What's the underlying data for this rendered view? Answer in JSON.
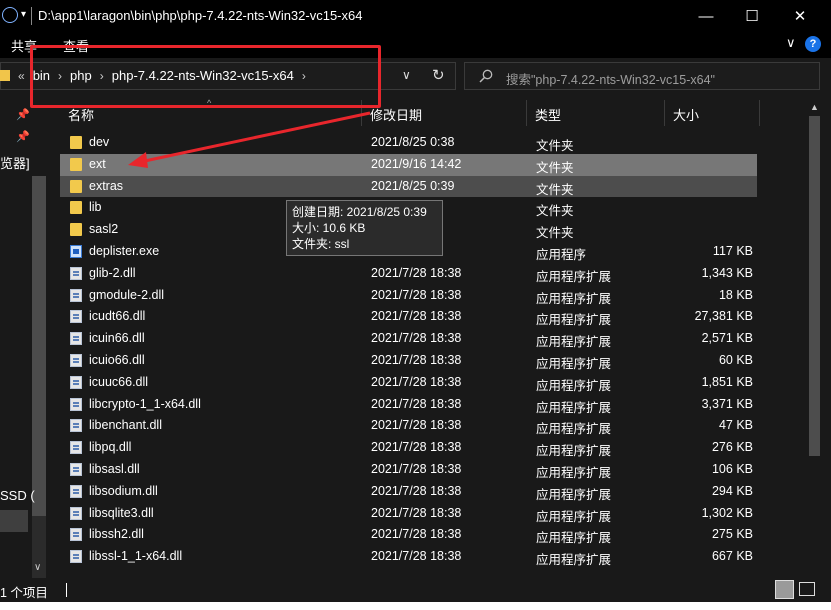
{
  "window": {
    "title_path": "D:\\app1\\laragon\\bin\\php\\php-7.4.22-nts-Win32-vc15-x64",
    "quick_access_arrow": "▾",
    "minimize": "—",
    "maximize": "☐",
    "close": "✕"
  },
  "ribbon": {
    "tabs": [
      "共享",
      "查看"
    ],
    "expand_chevron": "∨",
    "help": "?"
  },
  "address": {
    "overflow": "«",
    "crumbs": [
      "bin",
      "php",
      "php-7.4.22-nts-Win32-vc15-x64"
    ],
    "separator": "›",
    "dropdown": "∨",
    "refresh": "↻"
  },
  "search": {
    "icon": "search-icon",
    "placeholder": "搜索\"php-7.4.22-nts-Win32-vc15-x64\""
  },
  "nav": {
    "pins": [
      "📌",
      "📌"
    ],
    "label_1": "览器]",
    "label_2": "SSD (",
    "scroll_down": "∨"
  },
  "columns": {
    "name": "名称",
    "modified": "修改日期",
    "type": "类型",
    "size": "大小",
    "sort_caret": "^"
  },
  "files": [
    {
      "name": "dev",
      "date": "2021/8/25 0:38",
      "type": "文件夹",
      "size": "",
      "icon": "folder"
    },
    {
      "name": "ext",
      "date": "2021/9/16 14:42",
      "type": "文件夹",
      "size": "",
      "icon": "folder"
    },
    {
      "name": "extras",
      "date": "2021/8/25 0:39",
      "type": "文件夹",
      "size": "",
      "icon": "folder"
    },
    {
      "name": "lib",
      "date": "0:39",
      "type": "文件夹",
      "size": "",
      "icon": "folder"
    },
    {
      "name": "sasl2",
      "date": "0:39",
      "type": "文件夹",
      "size": "",
      "icon": "folder"
    },
    {
      "name": "deplister.exe",
      "date": "18:38",
      "type": "应用程序",
      "size": "117 KB",
      "icon": "exe"
    },
    {
      "name": "glib-2.dll",
      "date": "2021/7/28 18:38",
      "type": "应用程序扩展",
      "size": "1,343 KB",
      "icon": "file"
    },
    {
      "name": "gmodule-2.dll",
      "date": "2021/7/28 18:38",
      "type": "应用程序扩展",
      "size": "18 KB",
      "icon": "file"
    },
    {
      "name": "icudt66.dll",
      "date": "2021/7/28 18:38",
      "type": "应用程序扩展",
      "size": "27,381 KB",
      "icon": "file"
    },
    {
      "name": "icuin66.dll",
      "date": "2021/7/28 18:38",
      "type": "应用程序扩展",
      "size": "2,571 KB",
      "icon": "file"
    },
    {
      "name": "icuio66.dll",
      "date": "2021/7/28 18:38",
      "type": "应用程序扩展",
      "size": "60 KB",
      "icon": "file"
    },
    {
      "name": "icuuc66.dll",
      "date": "2021/7/28 18:38",
      "type": "应用程序扩展",
      "size": "1,851 KB",
      "icon": "file"
    },
    {
      "name": "libcrypto-1_1-x64.dll",
      "date": "2021/7/28 18:38",
      "type": "应用程序扩展",
      "size": "3,371 KB",
      "icon": "file"
    },
    {
      "name": "libenchant.dll",
      "date": "2021/7/28 18:38",
      "type": "应用程序扩展",
      "size": "47 KB",
      "icon": "file"
    },
    {
      "name": "libpq.dll",
      "date": "2021/7/28 18:38",
      "type": "应用程序扩展",
      "size": "276 KB",
      "icon": "file"
    },
    {
      "name": "libsasl.dll",
      "date": "2021/7/28 18:38",
      "type": "应用程序扩展",
      "size": "106 KB",
      "icon": "file"
    },
    {
      "name": "libsodium.dll",
      "date": "2021/7/28 18:38",
      "type": "应用程序扩展",
      "size": "294 KB",
      "icon": "file"
    },
    {
      "name": "libsqlite3.dll",
      "date": "2021/7/28 18:38",
      "type": "应用程序扩展",
      "size": "1,302 KB",
      "icon": "file"
    },
    {
      "name": "libssh2.dll",
      "date": "2021/7/28 18:38",
      "type": "应用程序扩展",
      "size": "275 KB",
      "icon": "file"
    },
    {
      "name": "libssl-1_1-x64.dll",
      "date": "2021/7/28 18:38",
      "type": "应用程序扩展",
      "size": "667 KB",
      "icon": "file"
    }
  ],
  "selected_row": "ext",
  "hover_row": "extras",
  "tooltip": {
    "created": "创建日期: 2021/8/25 0:39",
    "size": "大小: 10.6 KB",
    "files": "文件夹: ssl"
  },
  "status": {
    "item_count": "1 个项目"
  },
  "colors": {
    "background": "#191919",
    "selected_row": "#777777",
    "hover_row": "#4d4d4d",
    "folder_icon": "#f2c94c",
    "annotation_red": "#e8262c"
  }
}
